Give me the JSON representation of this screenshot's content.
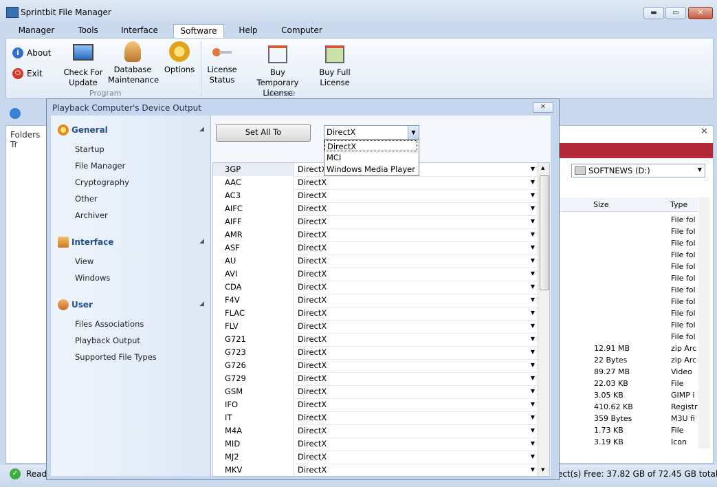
{
  "app": {
    "title": "Sprintbit File Manager",
    "minimize": "▬",
    "maximize": "▭",
    "close": "✕"
  },
  "ribbon_tabs": [
    "Manager",
    "Tools",
    "Interface",
    "Software",
    "Help",
    "Computer"
  ],
  "ribbon": {
    "about": "About",
    "exit": "Exit",
    "check_update": [
      "Check For",
      "Update"
    ],
    "db_maint": [
      "Database",
      "Maintenance"
    ],
    "options": "Options",
    "license_status": [
      "License",
      "Status"
    ],
    "buy_temp": [
      "Buy Temporary",
      "License"
    ],
    "buy_full": [
      "Buy Full",
      "License"
    ],
    "group_program": "Program",
    "group_license": "License"
  },
  "left_panel": {
    "title": "Folders Tr"
  },
  "right_panel": {
    "drive": "SOFTNEWS (D:)",
    "col_size": "Size",
    "col_type": "Type",
    "rows": [
      {
        "size": "",
        "type": "File fol"
      },
      {
        "size": "",
        "type": "File fol"
      },
      {
        "size": "",
        "type": "File fol"
      },
      {
        "size": "",
        "type": "File fol"
      },
      {
        "size": "",
        "type": "File fol"
      },
      {
        "size": "",
        "type": "File fol"
      },
      {
        "size": "",
        "type": "File fol"
      },
      {
        "size": "",
        "type": "File fol"
      },
      {
        "size": "",
        "type": "File fol"
      },
      {
        "size": "",
        "type": "File fol"
      },
      {
        "size": "",
        "type": "File fol"
      },
      {
        "size": "12.91 MB",
        "type": "zip Arc"
      },
      {
        "size": "22 Bytes",
        "type": "zip Arc"
      },
      {
        "size": "89.27 MB",
        "type": "Video"
      },
      {
        "size": "22.03 KB",
        "type": "File"
      },
      {
        "size": "3.05 KB",
        "type": "GIMP i"
      },
      {
        "size": "410.62 KB",
        "type": "Registr"
      },
      {
        "size": "359 Bytes",
        "type": "M3U fi"
      },
      {
        "size": "1.73 KB",
        "type": "File"
      },
      {
        "size": "3.19 KB",
        "type": "Icon"
      }
    ]
  },
  "status": {
    "ready": "Ready",
    "free": "bject(s) Free: 37.82 GB of 72.45 GB total"
  },
  "dialog": {
    "title": "Playback Computer's Device Output",
    "close": "✕",
    "categories": [
      {
        "name": "General",
        "items": [
          "Startup",
          "File Manager",
          "Cryptography",
          "Other",
          "Archiver"
        ]
      },
      {
        "name": "Interface",
        "items": [
          "View",
          "Windows"
        ]
      },
      {
        "name": "User",
        "items": [
          "Files Associations",
          "Playback Output",
          "Supported File Types"
        ]
      }
    ],
    "set_all_label": "Set All To",
    "combo_value": "DirectX",
    "dropdown_options": [
      "DirectX",
      "MCI",
      "Windows Media Player"
    ],
    "rows": [
      {
        "format": "3GP",
        "output": "DirectX"
      },
      {
        "format": "AAC",
        "output": "DirectX"
      },
      {
        "format": "AC3",
        "output": "DirectX"
      },
      {
        "format": "AIFC",
        "output": "DirectX"
      },
      {
        "format": "AIFF",
        "output": "DirectX"
      },
      {
        "format": "AMR",
        "output": "DirectX"
      },
      {
        "format": "ASF",
        "output": "DirectX"
      },
      {
        "format": "AU",
        "output": "DirectX"
      },
      {
        "format": "AVI",
        "output": "DirectX"
      },
      {
        "format": "CDA",
        "output": "DirectX"
      },
      {
        "format": "F4V",
        "output": "DirectX"
      },
      {
        "format": "FLAC",
        "output": "DirectX"
      },
      {
        "format": "FLV",
        "output": "DirectX"
      },
      {
        "format": "G721",
        "output": "DirectX"
      },
      {
        "format": "G723",
        "output": "DirectX"
      },
      {
        "format": "G726",
        "output": "DirectX"
      },
      {
        "format": "G729",
        "output": "DirectX"
      },
      {
        "format": "GSM",
        "output": "DirectX"
      },
      {
        "format": "IFO",
        "output": "DirectX"
      },
      {
        "format": "IT",
        "output": "DirectX"
      },
      {
        "format": "M4A",
        "output": "DirectX"
      },
      {
        "format": "MID",
        "output": "DirectX"
      },
      {
        "format": "MJ2",
        "output": "DirectX"
      },
      {
        "format": "MKV",
        "output": "DirectX"
      }
    ]
  },
  "colors": {
    "accent": "#27508e",
    "ribbon_bg": "#e2ebf6",
    "dialog_bg": "#c5d7ef",
    "banner_red": "#b32a3a"
  },
  "icons": [
    "app-icon",
    "info-icon",
    "exit-icon",
    "monitor-icon",
    "database-icon",
    "gears-icon",
    "key-icon",
    "cart-icon",
    "cart-full-icon",
    "gear-icon",
    "ui-icon",
    "user-icon",
    "drive-icon"
  ]
}
